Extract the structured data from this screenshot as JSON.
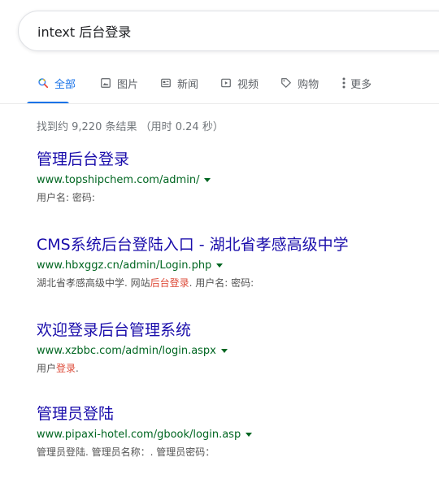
{
  "search": {
    "query": "intext 后台登录"
  },
  "tabs": {
    "all": {
      "label": "全部",
      "icon": "search-icon"
    },
    "images": {
      "label": "图片",
      "icon": "image-icon"
    },
    "news": {
      "label": "新闻",
      "icon": "news-icon"
    },
    "videos": {
      "label": "视频",
      "icon": "video-play-icon"
    },
    "shopping": {
      "label": "购物",
      "icon": "tag-icon"
    },
    "more": {
      "label": "更多",
      "icon": "more-vert-icon"
    }
  },
  "stats": "找到约 9,220 条结果 （用时 0.24 秒）",
  "results": [
    {
      "title": "管理后台登录",
      "url": "www.topshipchem.com/admin/",
      "snippet": {
        "before": "用户名: 密码:",
        "highlight": "",
        "after": ""
      }
    },
    {
      "title": "CMS系统后台登陆入口 - 湖北省孝感高级中学",
      "url": "www.hbxggz.cn/admin/Login.php",
      "snippet": {
        "before": "湖北省孝感高级中学. 网站",
        "highlight": "后台登录",
        "after": ". 用户名: 密码:"
      }
    },
    {
      "title": "欢迎登录后台管理系统",
      "url": "www.xzbbc.com/admin/login.aspx",
      "snippet": {
        "before": "用户",
        "highlight": "登录",
        "after": "."
      }
    },
    {
      "title": "管理员登陆",
      "url": "www.pipaxi-hotel.com/gbook/login.asp",
      "snippet": {
        "before": "管理员登陆. 管理员名称：. 管理员密码：",
        "highlight": "",
        "after": ""
      }
    }
  ],
  "colors": {
    "accent": "#1a73e8",
    "link": "#1a0dab",
    "url": "#006621",
    "highlight": "#dd4b39"
  }
}
